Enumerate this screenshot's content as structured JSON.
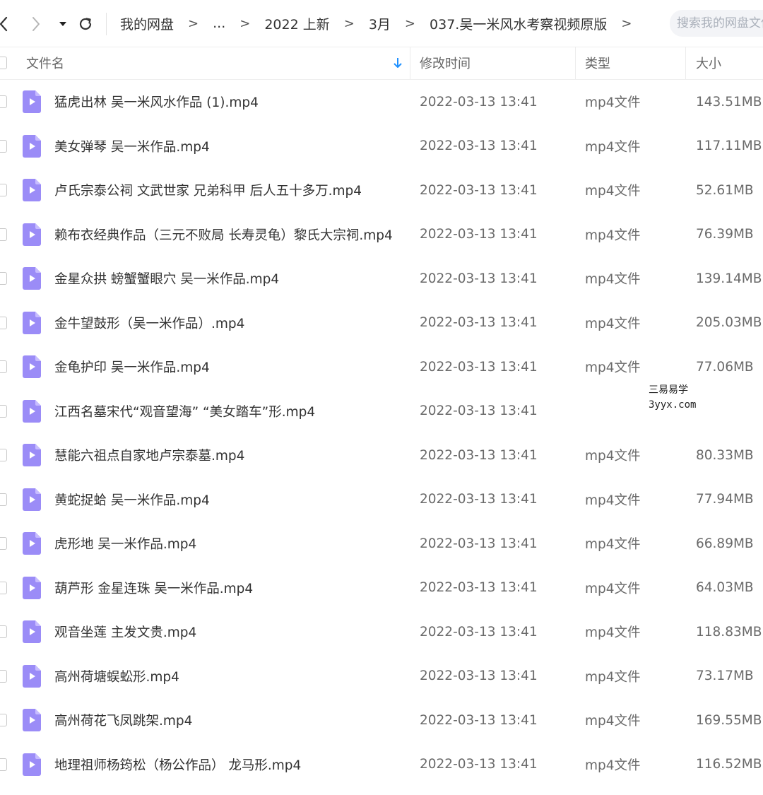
{
  "nav": {
    "back_icon": "chevron-left-icon",
    "forward_icon": "chevron-right-icon",
    "dropdown_icon": "caret-down-icon",
    "refresh_icon": "refresh-icon"
  },
  "breadcrumbs": [
    "我的网盘",
    "...",
    "2022 上新",
    "3月",
    "037.吴一米风水考察视频原版"
  ],
  "breadcrumb_separator": ">",
  "search": {
    "placeholder": "搜索我的网盘文件"
  },
  "columns": {
    "name": "文件名",
    "sort_icon": "sort-down-arrow-icon",
    "modified": "修改时间",
    "type": "类型",
    "size": "大小"
  },
  "files": [
    {
      "name": "猛虎出林 吴一米风水作品 (1).mp4",
      "modified": "2022-03-13 13:41",
      "type": "mp4文件",
      "size": "143.51MB"
    },
    {
      "name": "美女弹琴 吴一米作品.mp4",
      "modified": "2022-03-13 13:41",
      "type": "mp4文件",
      "size": "117.11MB"
    },
    {
      "name": "卢氏宗泰公祠 文武世家 兄弟科甲 后人五十多万.mp4",
      "modified": "2022-03-13 13:41",
      "type": "mp4文件",
      "size": "52.61MB"
    },
    {
      "name": "赖布衣经典作品（三元不败局 长寿灵龟）黎氏大宗祠.mp4",
      "modified": "2022-03-13 13:41",
      "type": "mp4文件",
      "size": "76.39MB"
    },
    {
      "name": "金星众拱 螃蟹蟹眼穴 吴一米作品.mp4",
      "modified": "2022-03-13 13:41",
      "type": "mp4文件",
      "size": "139.14MB"
    },
    {
      "name": "金牛望鼓形（吴一米作品）.mp4",
      "modified": "2022-03-13 13:41",
      "type": "mp4文件",
      "size": "205.03MB"
    },
    {
      "name": "金龟护印 吴一米作品.mp4",
      "modified": "2022-03-13 13:41",
      "type": "mp4文件",
      "size": "77.06MB"
    },
    {
      "name": "江西名墓宋代“观音望海” “美女踏车”形.mp4",
      "modified": "2022-03-13 13:41",
      "type": "",
      "size": ""
    },
    {
      "name": "慧能六祖点自家地卢宗泰墓.mp4",
      "modified": "2022-03-13 13:41",
      "type": "mp4文件",
      "size": "80.33MB"
    },
    {
      "name": "黄蛇捉蛤 吴一米作品.mp4",
      "modified": "2022-03-13 13:41",
      "type": "mp4文件",
      "size": "77.94MB"
    },
    {
      "name": "虎形地 吴一米作品.mp4",
      "modified": "2022-03-13 13:41",
      "type": "mp4文件",
      "size": "66.89MB"
    },
    {
      "name": "葫芦形 金星连珠 吴一米作品.mp4",
      "modified": "2022-03-13 13:41",
      "type": "mp4文件",
      "size": "64.03MB"
    },
    {
      "name": "观音坐莲 主发文贵.mp4",
      "modified": "2022-03-13 13:41",
      "type": "mp4文件",
      "size": "118.83MB"
    },
    {
      "name": "高州荷塘蜈蚣形.mp4",
      "modified": "2022-03-13 13:41",
      "type": "mp4文件",
      "size": "73.17MB"
    },
    {
      "name": "高州荷花飞凤跳架.mp4",
      "modified": "2022-03-13 13:41",
      "type": "mp4文件",
      "size": "169.55MB"
    },
    {
      "name": "地理祖师杨筠松（杨公作品） 龙马形.mp4",
      "modified": "2022-03-13 13:41",
      "type": "mp4文件",
      "size": "116.52MB"
    }
  ],
  "file_icon": "video-file-icon",
  "watermark": {
    "line1": "三易易学",
    "line2": "3yyx.com"
  },
  "colors": {
    "accent": "#1e90ff",
    "file_icon": "#9b8cf7",
    "text": "#333333",
    "muted": "#6a6a6a"
  }
}
